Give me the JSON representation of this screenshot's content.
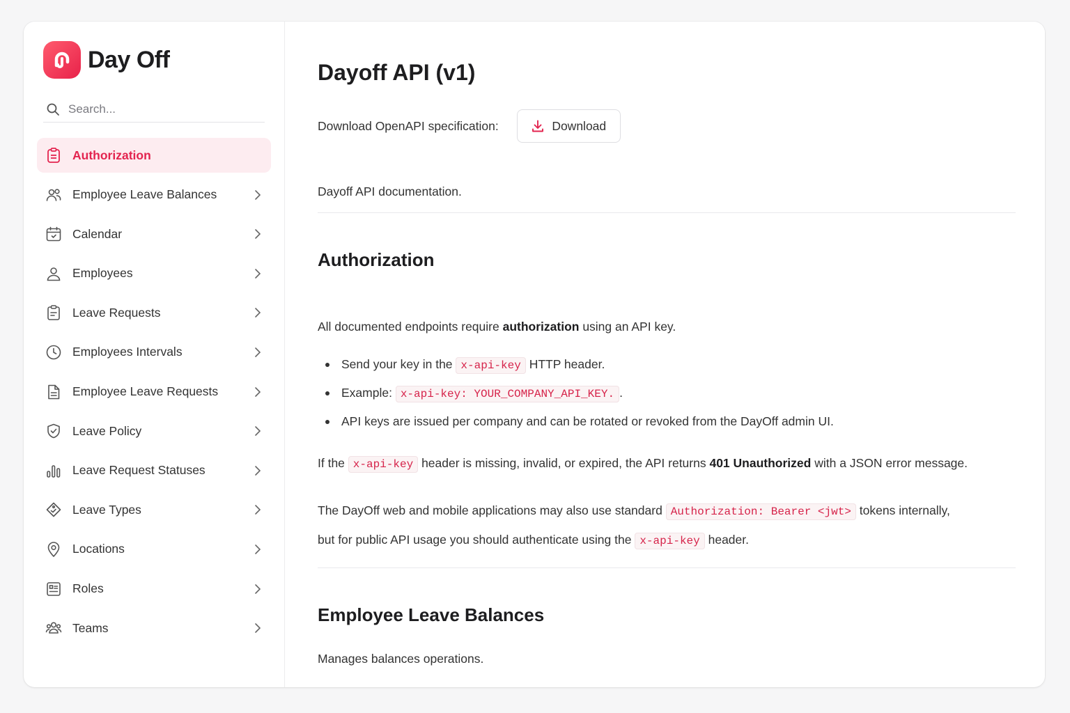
{
  "brand": {
    "name": "Day Off",
    "color": "#e8224a"
  },
  "search": {
    "placeholder": "Search..."
  },
  "sidebar": {
    "items": [
      {
        "label": "Authorization",
        "icon": "clipboard-icon",
        "active": true
      },
      {
        "label": "Employee Leave Balances",
        "icon": "users-icon"
      },
      {
        "label": "Calendar",
        "icon": "calendar-icon"
      },
      {
        "label": "Employees",
        "icon": "user-icon"
      },
      {
        "label": "Leave Requests",
        "icon": "clipboard-list-icon"
      },
      {
        "label": "Employees Intervals",
        "icon": "clock-icon"
      },
      {
        "label": "Employee Leave Requests",
        "icon": "document-icon"
      },
      {
        "label": "Leave Policy",
        "icon": "shield-icon"
      },
      {
        "label": "Leave Request Statuses",
        "icon": "bar-chart-icon"
      },
      {
        "label": "Leave Types",
        "icon": "tag-icon"
      },
      {
        "label": "Locations",
        "icon": "map-pin-icon"
      },
      {
        "label": "Roles",
        "icon": "id-card-icon"
      },
      {
        "label": "Teams",
        "icon": "team-icon"
      }
    ]
  },
  "main": {
    "title": "Dayoff API (v1)",
    "download_label": "Download OpenAPI specification:",
    "download_button": "Download",
    "intro": "Dayoff API documentation.",
    "auth": {
      "heading": "Authorization",
      "p1_before": "All documented endpoints require ",
      "p1_bold": "authorization",
      "p1_after": " using an API key.",
      "b1_before": "Send your key in the ",
      "b1_code": "x-api-key",
      "b1_after": " HTTP header.",
      "b2_before": "Example: ",
      "b2_code": "x-api-key: YOUR_COMPANY_API_KEY.",
      "b2_after": ".",
      "b3": "API keys are issued per company and can be rotated or revoked from the DayOff admin UI.",
      "p2_before": "If the ",
      "p2_code": "x-api-key",
      "p2_mid": " header is missing, invalid, or expired, the API returns ",
      "p2_bold": "401 Unauthorized",
      "p2_after": " with a JSON error message.",
      "p3_before": "The DayOff web and mobile applications may also use standard ",
      "p3_code": "Authorization: Bearer <jwt>",
      "p3_after": " tokens internally,",
      "p4_before": "but for public API usage you should authenticate using the ",
      "p4_code": "x-api-key",
      "p4_after": " header."
    },
    "balances": {
      "heading": "Employee Leave Balances",
      "desc": "Manages balances operations."
    }
  }
}
